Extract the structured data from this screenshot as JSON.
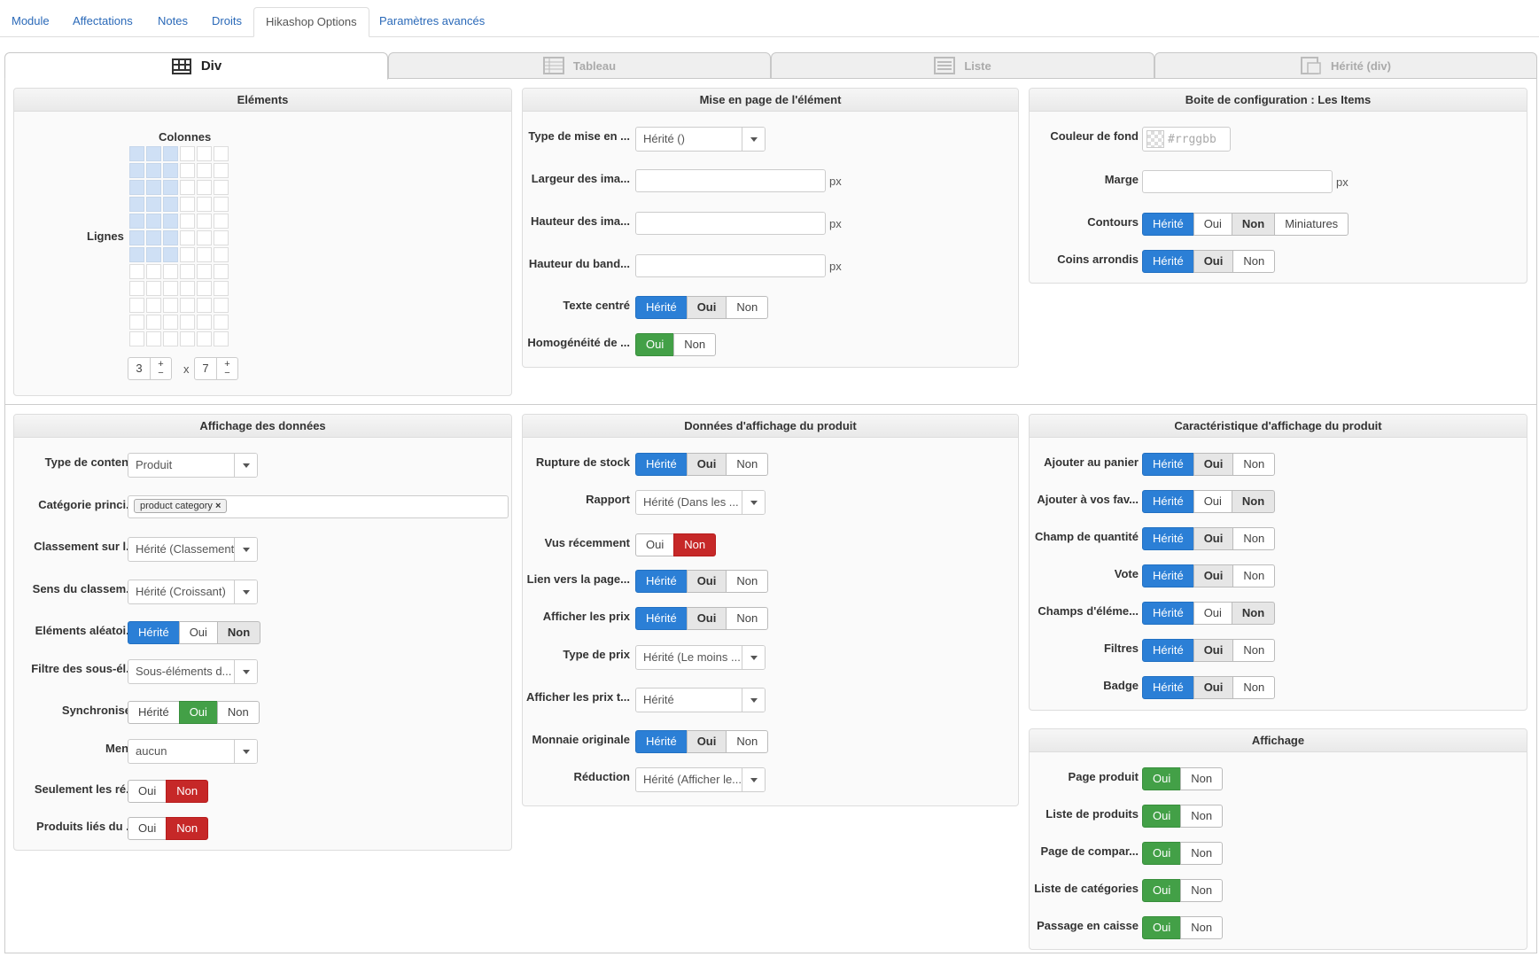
{
  "top_tabs": [
    "Module",
    "Affectations",
    "Notes",
    "Droits",
    "Hikashop Options",
    "Paramètres avancés"
  ],
  "view_tabs": [
    "Div",
    "Tableau",
    "Liste",
    "Hérité (div)"
  ],
  "elements": {
    "title": "Eléments",
    "columns_label": "Colonnes",
    "rows_label": "Lignes",
    "columns": "3",
    "rows": "7",
    "x": "x",
    "plus": "+",
    "minus": "−"
  },
  "layout": {
    "title": "Mise en page de l'élément",
    "type_label": "Type de mise en ...",
    "type_value": "Hérité ()",
    "img_width_label": "Largeur des ima...",
    "img_height_label": "Hauteur des ima...",
    "band_height_label": "Hauteur du band...",
    "unit": "px",
    "centered_label": "Texte centré",
    "homog_label": "Homogénéité de ..."
  },
  "config": {
    "title": "Boite de configuration : Les Items",
    "bg_label": "Couleur de fond",
    "bg_placeholder": "#rrggbb",
    "margin_label": "Marge",
    "unit": "px",
    "border_label": "Contours",
    "rounded_label": "Coins arrondis"
  },
  "data_display": {
    "title": "Affichage des données",
    "content_type_label": "Type de contenu",
    "content_type_value": "Produit",
    "main_cat_label": "Catégorie princi...",
    "main_cat_tag": "product category",
    "tag_remove": "×",
    "order_label": "Classement sur l...",
    "order_value": "Hérité (Classement)",
    "order_dir_label": "Sens du classem...",
    "order_dir_value": "Hérité (Croissant)",
    "random_label": "Eléments aléatoi...",
    "filter_label": "Filtre des sous-él...",
    "filter_value": "Sous-éléments d...",
    "sync_label": "Synchroniser",
    "menu_label": "Menu",
    "menu_value": "aucun",
    "only_label": "Seulement les ré...",
    "related_label": "Produits liés du ..."
  },
  "product_data": {
    "title": "Données d'affichage du produit",
    "stock_label": "Rupture de stock",
    "report_label": "Rapport",
    "report_value": "Hérité (Dans les ...",
    "recent_label": "Vus récemment",
    "link_label": "Lien vers la page...",
    "show_price_label": "Afficher les prix",
    "price_type_label": "Type de prix",
    "price_type_value": "Hérité (Le moins ...",
    "show_price_t_label": "Afficher les prix t...",
    "show_price_t_value": "Hérité",
    "orig_currency_label": "Monnaie originale",
    "discount_label": "Réduction",
    "discount_value": "Hérité (Afficher le..."
  },
  "product_features": {
    "title": "Caractéristique d'affichage du produit",
    "cart_label": "Ajouter au panier",
    "fav_label": "Ajouter à vos fav...",
    "qty_label": "Champ de quantité",
    "vote_label": "Vote",
    "fields_label": "Champs d'éléme...",
    "filters_label": "Filtres",
    "badge_label": "Badge"
  },
  "display": {
    "title": "Affichage",
    "product_page_label": "Page produit",
    "product_list_label": "Liste de produits",
    "compare_label": "Page de compar...",
    "cat_list_label": "Liste de catégories",
    "checkout_label": "Passage en caisse"
  },
  "options": {
    "herite": "Hérité",
    "oui": "Oui",
    "non": "Non",
    "miniatures": "Miniatures"
  }
}
